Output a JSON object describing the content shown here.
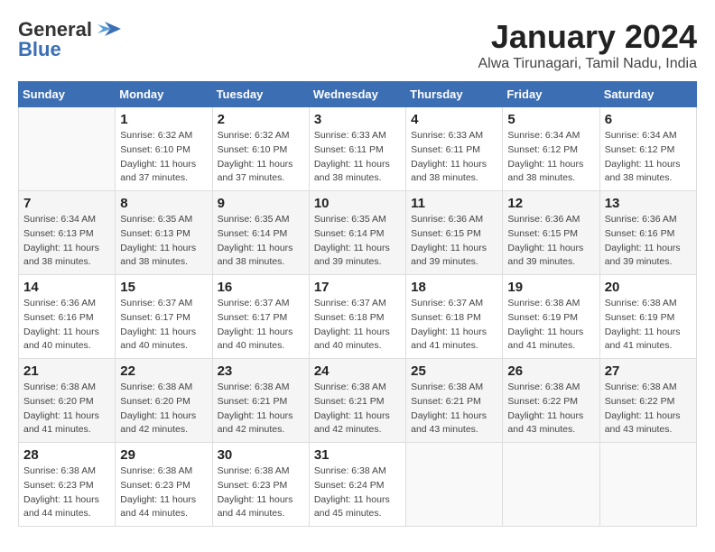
{
  "logo": {
    "general": "General",
    "blue": "Blue",
    "bird_icon": "▶"
  },
  "title": "January 2024",
  "subtitle": "Alwa Tirunagari, Tamil Nadu, India",
  "days_header": [
    "Sunday",
    "Monday",
    "Tuesday",
    "Wednesday",
    "Thursday",
    "Friday",
    "Saturday"
  ],
  "weeks": [
    [
      {
        "day": "",
        "sunrise": "",
        "sunset": "",
        "daylight": ""
      },
      {
        "day": "1",
        "sunrise": "Sunrise: 6:32 AM",
        "sunset": "Sunset: 6:10 PM",
        "daylight": "Daylight: 11 hours and 37 minutes."
      },
      {
        "day": "2",
        "sunrise": "Sunrise: 6:32 AM",
        "sunset": "Sunset: 6:10 PM",
        "daylight": "Daylight: 11 hours and 37 minutes."
      },
      {
        "day": "3",
        "sunrise": "Sunrise: 6:33 AM",
        "sunset": "Sunset: 6:11 PM",
        "daylight": "Daylight: 11 hours and 38 minutes."
      },
      {
        "day": "4",
        "sunrise": "Sunrise: 6:33 AM",
        "sunset": "Sunset: 6:11 PM",
        "daylight": "Daylight: 11 hours and 38 minutes."
      },
      {
        "day": "5",
        "sunrise": "Sunrise: 6:34 AM",
        "sunset": "Sunset: 6:12 PM",
        "daylight": "Daylight: 11 hours and 38 minutes."
      },
      {
        "day": "6",
        "sunrise": "Sunrise: 6:34 AM",
        "sunset": "Sunset: 6:12 PM",
        "daylight": "Daylight: 11 hours and 38 minutes."
      }
    ],
    [
      {
        "day": "7",
        "sunrise": "Sunrise: 6:34 AM",
        "sunset": "Sunset: 6:13 PM",
        "daylight": "Daylight: 11 hours and 38 minutes."
      },
      {
        "day": "8",
        "sunrise": "Sunrise: 6:35 AM",
        "sunset": "Sunset: 6:13 PM",
        "daylight": "Daylight: 11 hours and 38 minutes."
      },
      {
        "day": "9",
        "sunrise": "Sunrise: 6:35 AM",
        "sunset": "Sunset: 6:14 PM",
        "daylight": "Daylight: 11 hours and 38 minutes."
      },
      {
        "day": "10",
        "sunrise": "Sunrise: 6:35 AM",
        "sunset": "Sunset: 6:14 PM",
        "daylight": "Daylight: 11 hours and 39 minutes."
      },
      {
        "day": "11",
        "sunrise": "Sunrise: 6:36 AM",
        "sunset": "Sunset: 6:15 PM",
        "daylight": "Daylight: 11 hours and 39 minutes."
      },
      {
        "day": "12",
        "sunrise": "Sunrise: 6:36 AM",
        "sunset": "Sunset: 6:15 PM",
        "daylight": "Daylight: 11 hours and 39 minutes."
      },
      {
        "day": "13",
        "sunrise": "Sunrise: 6:36 AM",
        "sunset": "Sunset: 6:16 PM",
        "daylight": "Daylight: 11 hours and 39 minutes."
      }
    ],
    [
      {
        "day": "14",
        "sunrise": "Sunrise: 6:36 AM",
        "sunset": "Sunset: 6:16 PM",
        "daylight": "Daylight: 11 hours and 40 minutes."
      },
      {
        "day": "15",
        "sunrise": "Sunrise: 6:37 AM",
        "sunset": "Sunset: 6:17 PM",
        "daylight": "Daylight: 11 hours and 40 minutes."
      },
      {
        "day": "16",
        "sunrise": "Sunrise: 6:37 AM",
        "sunset": "Sunset: 6:17 PM",
        "daylight": "Daylight: 11 hours and 40 minutes."
      },
      {
        "day": "17",
        "sunrise": "Sunrise: 6:37 AM",
        "sunset": "Sunset: 6:18 PM",
        "daylight": "Daylight: 11 hours and 40 minutes."
      },
      {
        "day": "18",
        "sunrise": "Sunrise: 6:37 AM",
        "sunset": "Sunset: 6:18 PM",
        "daylight": "Daylight: 11 hours and 41 minutes."
      },
      {
        "day": "19",
        "sunrise": "Sunrise: 6:38 AM",
        "sunset": "Sunset: 6:19 PM",
        "daylight": "Daylight: 11 hours and 41 minutes."
      },
      {
        "day": "20",
        "sunrise": "Sunrise: 6:38 AM",
        "sunset": "Sunset: 6:19 PM",
        "daylight": "Daylight: 11 hours and 41 minutes."
      }
    ],
    [
      {
        "day": "21",
        "sunrise": "Sunrise: 6:38 AM",
        "sunset": "Sunset: 6:20 PM",
        "daylight": "Daylight: 11 hours and 41 minutes."
      },
      {
        "day": "22",
        "sunrise": "Sunrise: 6:38 AM",
        "sunset": "Sunset: 6:20 PM",
        "daylight": "Daylight: 11 hours and 42 minutes."
      },
      {
        "day": "23",
        "sunrise": "Sunrise: 6:38 AM",
        "sunset": "Sunset: 6:21 PM",
        "daylight": "Daylight: 11 hours and 42 minutes."
      },
      {
        "day": "24",
        "sunrise": "Sunrise: 6:38 AM",
        "sunset": "Sunset: 6:21 PM",
        "daylight": "Daylight: 11 hours and 42 minutes."
      },
      {
        "day": "25",
        "sunrise": "Sunrise: 6:38 AM",
        "sunset": "Sunset: 6:21 PM",
        "daylight": "Daylight: 11 hours and 43 minutes."
      },
      {
        "day": "26",
        "sunrise": "Sunrise: 6:38 AM",
        "sunset": "Sunset: 6:22 PM",
        "daylight": "Daylight: 11 hours and 43 minutes."
      },
      {
        "day": "27",
        "sunrise": "Sunrise: 6:38 AM",
        "sunset": "Sunset: 6:22 PM",
        "daylight": "Daylight: 11 hours and 43 minutes."
      }
    ],
    [
      {
        "day": "28",
        "sunrise": "Sunrise: 6:38 AM",
        "sunset": "Sunset: 6:23 PM",
        "daylight": "Daylight: 11 hours and 44 minutes."
      },
      {
        "day": "29",
        "sunrise": "Sunrise: 6:38 AM",
        "sunset": "Sunset: 6:23 PM",
        "daylight": "Daylight: 11 hours and 44 minutes."
      },
      {
        "day": "30",
        "sunrise": "Sunrise: 6:38 AM",
        "sunset": "Sunset: 6:23 PM",
        "daylight": "Daylight: 11 hours and 44 minutes."
      },
      {
        "day": "31",
        "sunrise": "Sunrise: 6:38 AM",
        "sunset": "Sunset: 6:24 PM",
        "daylight": "Daylight: 11 hours and 45 minutes."
      },
      {
        "day": "",
        "sunrise": "",
        "sunset": "",
        "daylight": ""
      },
      {
        "day": "",
        "sunrise": "",
        "sunset": "",
        "daylight": ""
      },
      {
        "day": "",
        "sunrise": "",
        "sunset": "",
        "daylight": ""
      }
    ]
  ]
}
